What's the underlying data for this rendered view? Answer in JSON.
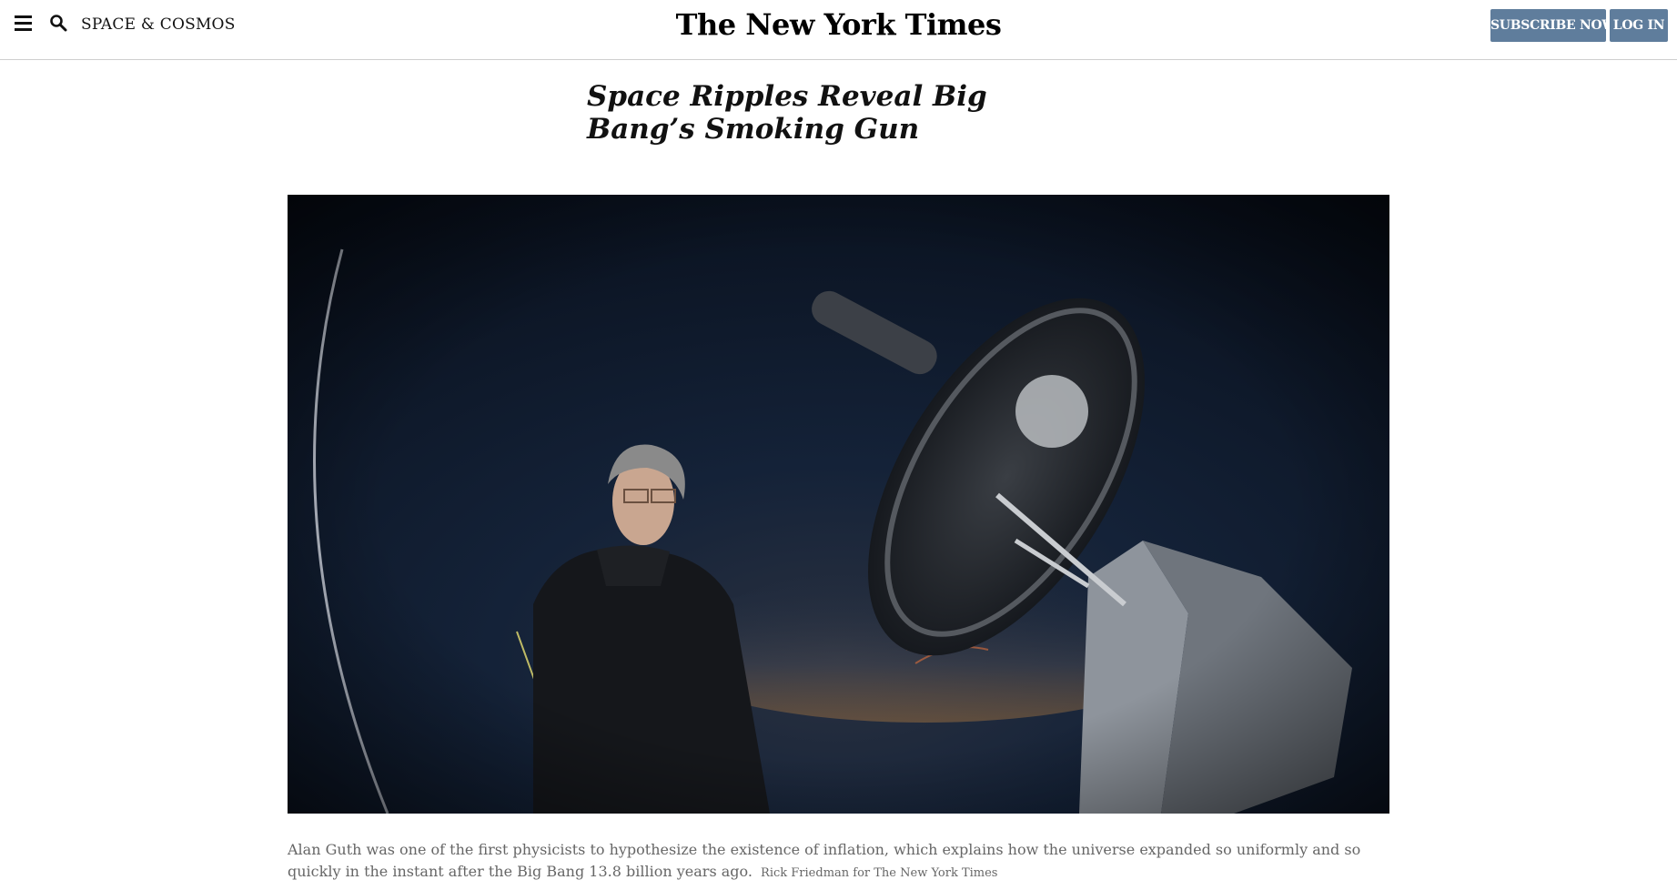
{
  "header": {
    "section_label": "SPACE & COSMOS",
    "logo_text": "The New York Times",
    "subscribe_label": "SUBSCRIBE NOW",
    "login_label": "LOG IN",
    "button_color": "#5f7d9c"
  },
  "article": {
    "headline": "Space Ripples Reveal Big Bang’s Smoking Gun",
    "image": {
      "subject": "photo-man-beside-telescope-at-night"
    },
    "caption": "Alan Guth was one of the first physicists to hypothesize the existence of inflation, which explains how the universe expanded so uniformly and so quickly in the instant after the Big Bang 13.8 billion years ago.",
    "credit": "Rick Friedman for The New York Times"
  }
}
